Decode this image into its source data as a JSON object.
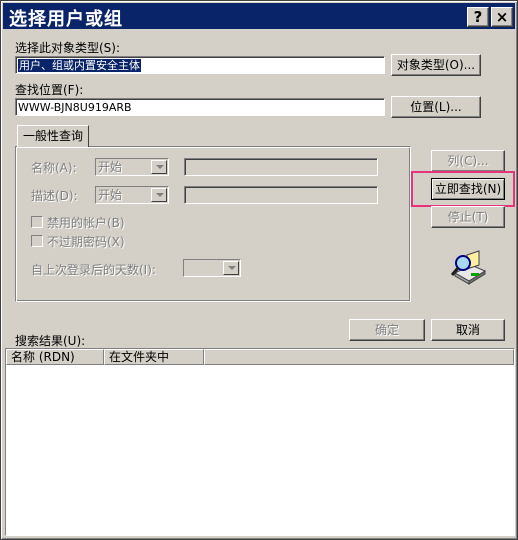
{
  "window": {
    "title": "选择用户或组"
  },
  "titlebar_buttons": {
    "help": "?",
    "close": "×"
  },
  "object_types": {
    "label": "选择此对象类型(S):",
    "value": "用户、组或内置安全主体",
    "button": "对象类型(O)..."
  },
  "location": {
    "label": "查找位置(F):",
    "value": "WWW-BJN8U919ARB",
    "button": "位置(L)..."
  },
  "query_tab": {
    "tab_label": "一般性查询",
    "name_label": "名称(A):",
    "name_mode": "开始",
    "description_label": "描述(D):",
    "description_mode": "开始",
    "disabled_accounts": "禁用的帐户(B)",
    "non_expiring_password": "不过期密码(X)",
    "days_since_logon_label": "自上次登录后的天数(I):"
  },
  "side_buttons": {
    "columns": "列(C)...",
    "find_now": "立即查找(N)",
    "stop": "停止(T)"
  },
  "dialog_buttons": {
    "ok": "确定",
    "cancel": "取消"
  },
  "results": {
    "label": "搜索结果(U):",
    "columns": [
      "名称 (RDN)",
      "在文件夹中"
    ]
  },
  "colors": {
    "titlebar": "#0a246a",
    "highlight_box": "#e8327a",
    "face": "#d4d0c8"
  }
}
